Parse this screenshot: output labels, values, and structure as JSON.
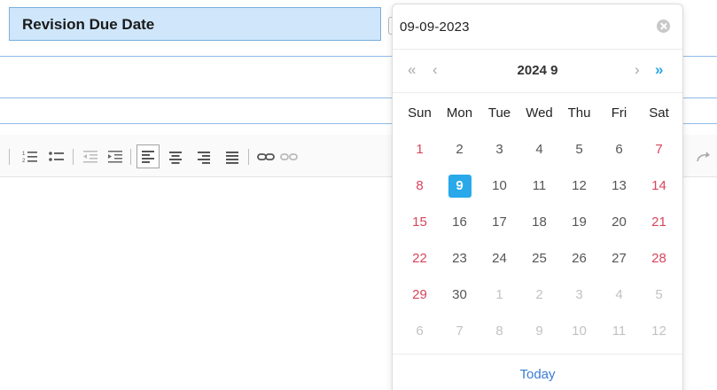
{
  "form": {
    "field_label": "Revision Due Date"
  },
  "toolbar": {
    "buttons": [
      "ordered-list-icon",
      "unordered-list-icon",
      "outdent-icon",
      "indent-icon",
      "align-left-icon",
      "align-center-icon",
      "align-right-icon",
      "justify-icon",
      "link-icon",
      "unlink-icon"
    ],
    "active_button": "align-left-icon"
  },
  "datepicker": {
    "input_value": "09-09-2023",
    "header_title": "2024 9",
    "nav": {
      "prev_year": "«",
      "prev_month": "‹",
      "next_month": "›",
      "next_year": "»"
    },
    "weekdays": [
      "Sun",
      "Mon",
      "Tue",
      "Wed",
      "Thu",
      "Fri",
      "Sat"
    ],
    "weeks": [
      [
        "1",
        "2",
        "3",
        "4",
        "5",
        "6",
        "7"
      ],
      [
        "8",
        "9",
        "10",
        "11",
        "12",
        "13",
        "14"
      ],
      [
        "15",
        "16",
        "17",
        "18",
        "19",
        "20",
        "21"
      ],
      [
        "22",
        "23",
        "24",
        "25",
        "26",
        "27",
        "28"
      ],
      [
        "29",
        "30",
        "1",
        "2",
        "3",
        "4",
        "5"
      ],
      [
        "6",
        "7",
        "8",
        "9",
        "10",
        "11",
        "12"
      ]
    ],
    "selected_day": "9",
    "today_label": "Today",
    "colors": {
      "accent": "#29a8ea",
      "weekend": "#d9455d",
      "other_month": "#c2c2c2",
      "link": "#3a7bd5"
    }
  }
}
